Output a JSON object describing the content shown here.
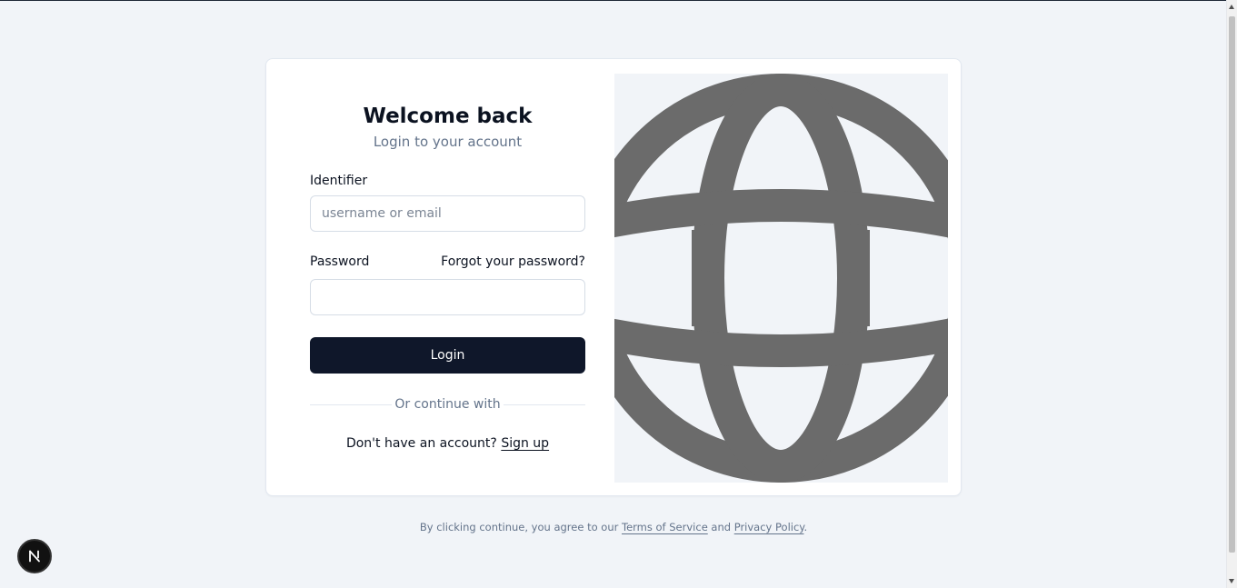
{
  "login": {
    "title": "Welcome back",
    "subtitle": "Login to your account",
    "identifier_label": "Identifier",
    "identifier_placeholder": "username or email",
    "identifier_value": "",
    "password_label": "Password",
    "password_value": "",
    "forgot_link": "Forgot your password?",
    "login_button": "Login",
    "divider_text": "Or continue with",
    "signup_prompt": "Don't have an account?",
    "signup_link": "Sign up"
  },
  "footer": {
    "prefix": "By clicking continue, you agree to our",
    "terms_link": "Terms of Service",
    "and_text": "and",
    "privacy_link": "Privacy Policy",
    "suffix": "."
  },
  "badge": {
    "letter": "N"
  },
  "colors": {
    "page_bg": "#f1f4f8",
    "card_bg": "#ffffff",
    "primary_button": "#0f172a",
    "globe_gray": "#6b6b6b",
    "muted_text": "#64748b"
  },
  "icons": {
    "hero_image": "globe-icon",
    "dev_badge": "nextjs-n-icon"
  }
}
